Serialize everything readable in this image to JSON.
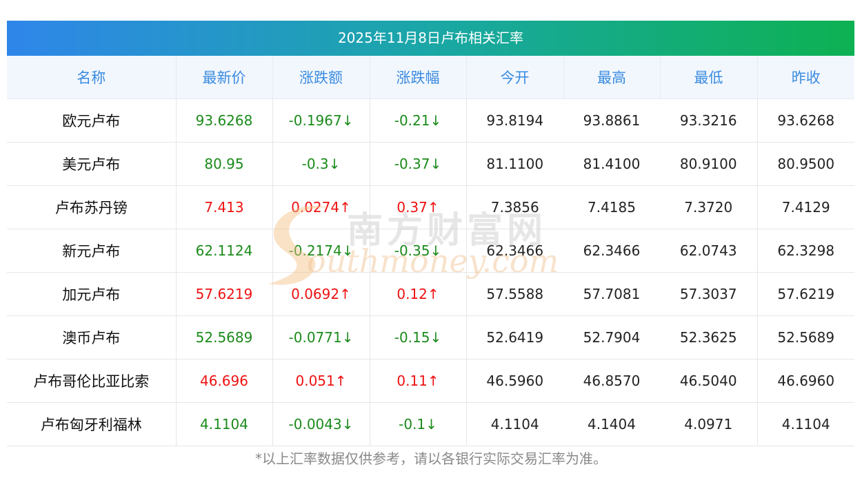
{
  "title": "2025年11月8日卢布相关汇率",
  "headers": [
    "名称",
    "最新价",
    "涨跌额",
    "涨跌幅",
    "今开",
    "最高",
    "最低",
    "昨收"
  ],
  "rows": [
    {
      "name": "欧元卢布",
      "latest": "93.6268",
      "change": "-0.1967↓",
      "pct": "-0.21↓",
      "open": "93.8194",
      "high": "93.8861",
      "low": "93.3216",
      "prev": "93.6268",
      "trend": "down"
    },
    {
      "name": "美元卢布",
      "latest": "80.95",
      "change": "-0.3↓",
      "pct": "-0.37↓",
      "open": "81.1100",
      "high": "81.4100",
      "low": "80.9100",
      "prev": "80.9500",
      "trend": "down"
    },
    {
      "name": "卢布苏丹镑",
      "latest": "7.413",
      "change": "0.0274↑",
      "pct": "0.37↑",
      "open": "7.3856",
      "high": "7.4185",
      "low": "7.3720",
      "prev": "7.4129",
      "trend": "up"
    },
    {
      "name": "新元卢布",
      "latest": "62.1124",
      "change": "-0.2174↓",
      "pct": "-0.35↓",
      "open": "62.3466",
      "high": "62.3466",
      "low": "62.0743",
      "prev": "62.3298",
      "trend": "down"
    },
    {
      "name": "加元卢布",
      "latest": "57.6219",
      "change": "0.0692↑",
      "pct": "0.12↑",
      "open": "57.5588",
      "high": "57.7081",
      "low": "57.3037",
      "prev": "57.6219",
      "trend": "up"
    },
    {
      "name": "澳币卢布",
      "latest": "52.5689",
      "change": "-0.0771↓",
      "pct": "-0.15↓",
      "open": "52.6419",
      "high": "52.7904",
      "low": "52.3625",
      "prev": "52.5689",
      "trend": "down"
    },
    {
      "name": "卢布哥伦比亚比索",
      "latest": "46.696",
      "change": "0.051↑",
      "pct": "0.11↑",
      "open": "46.5960",
      "high": "46.8570",
      "low": "46.5040",
      "prev": "46.6960",
      "trend": "up"
    },
    {
      "name": "卢布匈牙利福林",
      "latest": "4.1104",
      "change": "-0.0043↓",
      "pct": "-0.1↓",
      "open": "4.1104",
      "high": "4.1404",
      "low": "4.0971",
      "prev": "4.1104",
      "trend": "down"
    }
  ],
  "note": "*以上汇率数据仅供参考，请以各银行实际交易汇率为准。",
  "watermark": {
    "cn": "南方财富网",
    "en": "outhmoney.com"
  },
  "colors": {
    "up": "#ee1111",
    "down": "#1a8a1a",
    "header_text": "#3a8be0",
    "title_gradient_start": "#2f86ea",
    "title_gradient_end": "#0db152"
  }
}
